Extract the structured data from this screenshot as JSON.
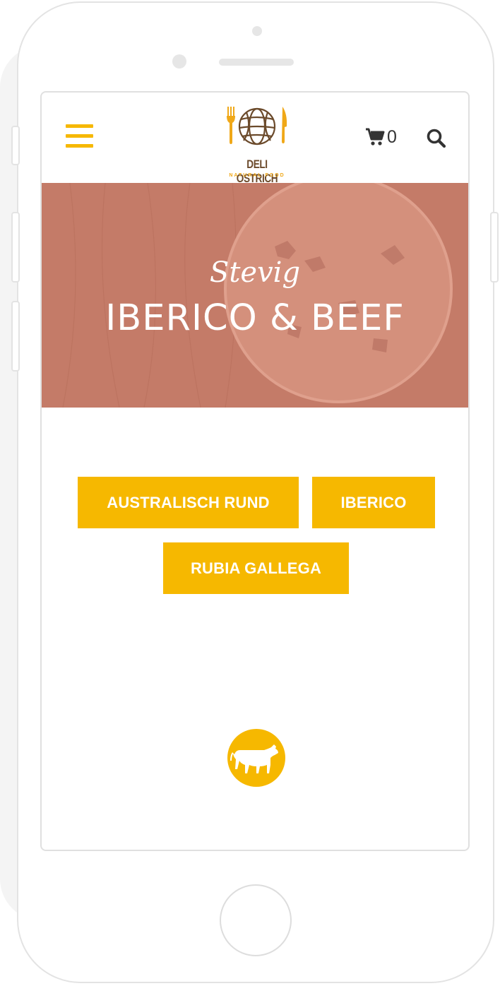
{
  "header": {
    "logo_title": "DELI OSTRICH",
    "logo_subtitle": "NATURAL FOOD",
    "cart_count": "0",
    "menu_icon": "hamburger-menu-icon",
    "cart_icon": "shopping-cart-icon",
    "search_icon": "search-icon"
  },
  "hero": {
    "overline": "Stevig",
    "title": "IBERICO & BEEF"
  },
  "categories": [
    {
      "label": "AUSTRALISCH RUND"
    },
    {
      "label": "IBERICO"
    },
    {
      "label": "RUBIA GALLEGA"
    }
  ],
  "badge": {
    "icon": "cow-icon"
  },
  "colors": {
    "accent": "#f6b800",
    "hero_tint": "#c47b68",
    "logo_brown": "#6b4a2b",
    "logo_orange": "#f0a818",
    "icon_dark": "#333333"
  }
}
